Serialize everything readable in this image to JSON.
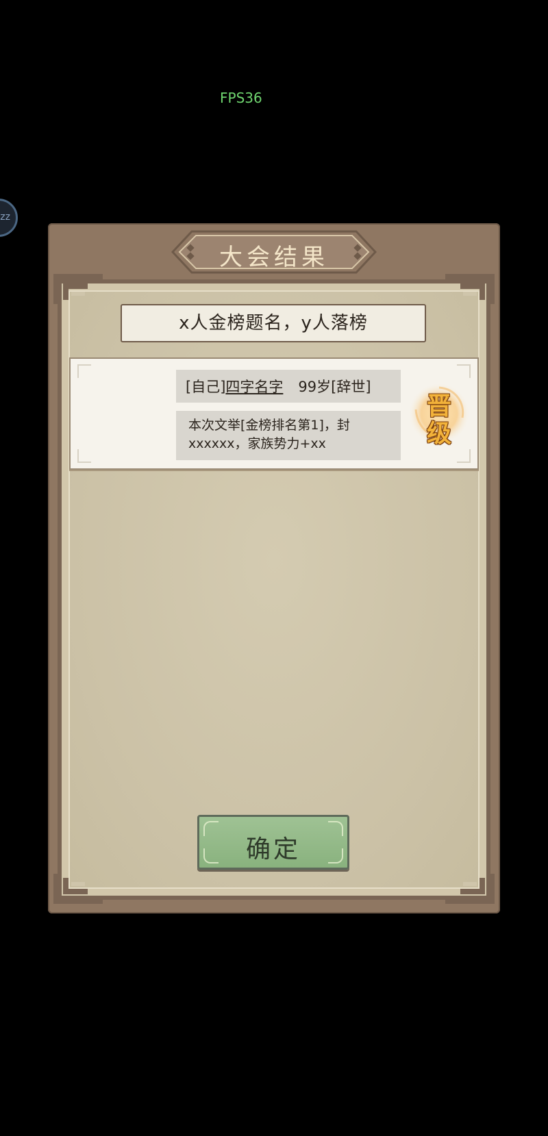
{
  "hud": {
    "fps_text": "FPS36",
    "side_bubble_text": "zz"
  },
  "dialog": {
    "title": "大会结果",
    "summary": "x人金榜题名，y人落榜",
    "result": {
      "prefix": "[自己]",
      "name": "四字名字",
      "age": "99岁",
      "status": "[辞世]",
      "description": "本次文举[金榜排名第1]，封xxxxxx，家族势力+xx",
      "badge_line1": "晋",
      "badge_line2": "级"
    },
    "confirm_label": "确定"
  },
  "colors": {
    "frame": "#8f7762",
    "paper": "#d2c7ab",
    "button_green": "#89b27e",
    "badge_gold": "#f2b23a",
    "fps_green": "#6fd56f"
  }
}
